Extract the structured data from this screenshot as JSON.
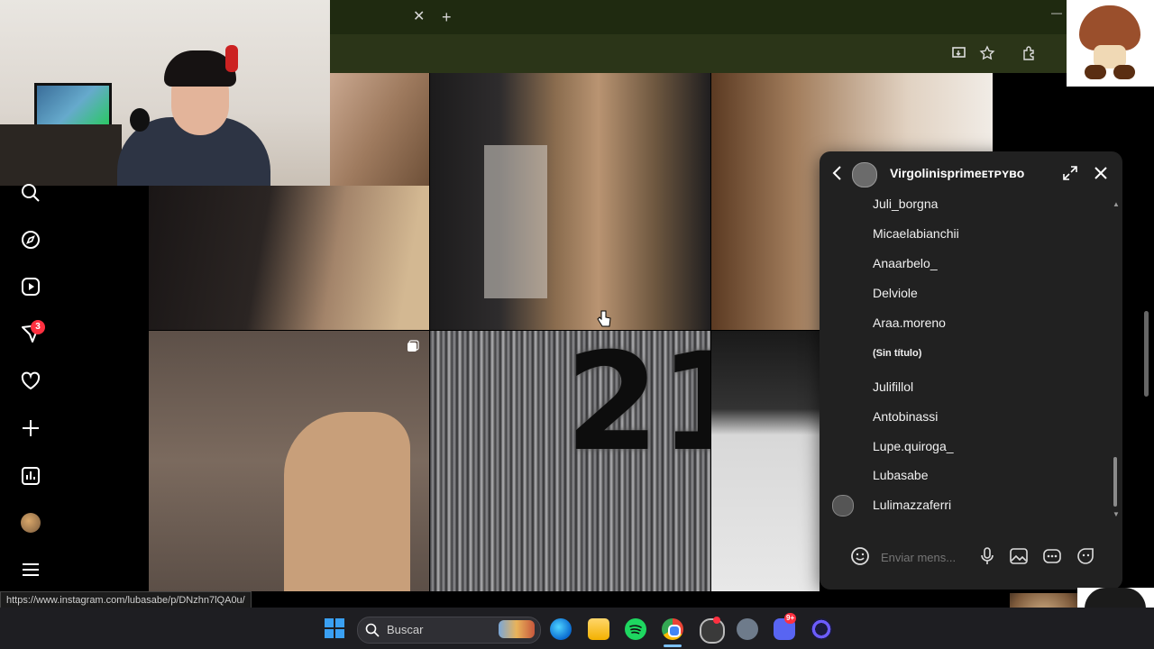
{
  "browser": {
    "close_tab_glyph": "✕",
    "new_tab_glyph": "+",
    "minimize_glyph": "—"
  },
  "sidebar": {
    "icons": [
      "search-icon",
      "explore-icon",
      "reels-icon",
      "messages-icon",
      "notifications-icon",
      "create-icon",
      "insights-icon",
      "profile-avatar",
      "menu-icon"
    ],
    "messages_badge": "3"
  },
  "grid": {
    "tile_numbers_text": "21"
  },
  "chat": {
    "title": "Virgolinisprimeᴇᴛᴘʏʙᴏ",
    "participants": [
      "Juli_borgna",
      "Micaelabianchii",
      "Anaarbelo_",
      "Delviole",
      "Araa.moreno",
      "(Sin título)",
      "Julifillol",
      "Antobinassi",
      "Lupe.quiroga_",
      "Lubasabe",
      "Lulimazzaferri"
    ],
    "input_placeholder": "Enviar mens..."
  },
  "status_bar": {
    "url": "https://www.instagram.com/lubasabe/p/DNzhn7lQA0u/"
  },
  "taskbar": {
    "search_placeholder": "Buscar",
    "discord_badge": "9+"
  },
  "colors": {
    "tabbar": "#1f2a10",
    "chat_bg": "#212121",
    "badge_red": "#ff3040",
    "windows_blue": "#3aa0f3"
  }
}
